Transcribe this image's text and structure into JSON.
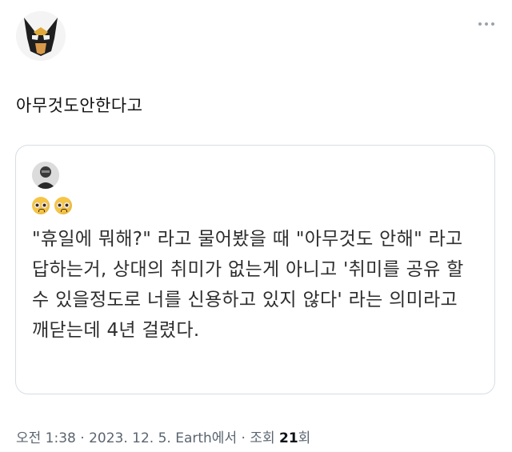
{
  "author": {
    "avatar_icon": "wolverine-mask-icon"
  },
  "post": {
    "text": "아무것도안한다고"
  },
  "quoted": {
    "avatar_icon": "person-portrait-icon",
    "emoji": [
      "pleading-face-emoji",
      "pleading-face-emoji"
    ],
    "text": "\"휴일에 뭐해?\" 라고 물어봤을 때 \"아무것도 안해\" 라고 답하는거, 상대의 취미가 없는게 아니고 '취미를 공유 할 수 있을정도로 너를 신용하고 있지 않다' 라는 의미라고 깨닫는데 4년 걸렸다."
  },
  "meta": {
    "time": "오전 1:38",
    "date": "2023. 12. 5.",
    "source": "Earth에서",
    "views_label": "조회",
    "views_count": "21",
    "views_suffix": "회",
    "separator": "·"
  },
  "colors": {
    "border": "#d7dee3",
    "meta": "#5b6570",
    "text": "#0f1419"
  }
}
